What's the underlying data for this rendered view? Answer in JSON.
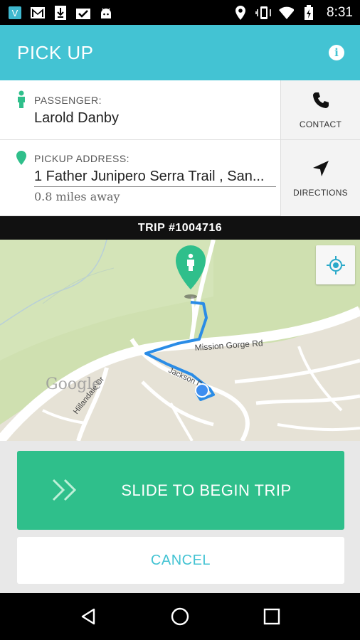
{
  "status_bar": {
    "time": "8:31",
    "icons_left": [
      "app-icon",
      "gmail-icon",
      "download-icon",
      "checklist-icon",
      "android-icon"
    ],
    "icons_right": [
      "location-icon",
      "vibrate-icon",
      "wifi-icon",
      "battery-icon"
    ]
  },
  "header": {
    "title": "PICK UP",
    "info_icon": "info-icon",
    "color": "#43c3d3"
  },
  "passenger": {
    "label": "PASSENGER:",
    "name": "Larold Danby"
  },
  "pickup": {
    "label": "PICKUP ADDRESS:",
    "address": "1 Father Junipero Serra Trail , San...",
    "distance": "0.8 miles away"
  },
  "actions": {
    "contact_label": "CONTACT",
    "directions_label": "DIRECTIONS"
  },
  "trip": {
    "label": "TRIP #1004716"
  },
  "map": {
    "street_1": "Mission Gorge Rd",
    "street_2": "Jackson Dr",
    "street_3": "Hillandale Dr",
    "watermark": "Google"
  },
  "slide": {
    "label": "SLIDE TO BEGIN TRIP",
    "color": "#2fbf8b"
  },
  "cancel": {
    "label": "CANCEL"
  },
  "nav": {
    "icons": [
      "back-icon",
      "home-icon",
      "recents-icon"
    ]
  }
}
